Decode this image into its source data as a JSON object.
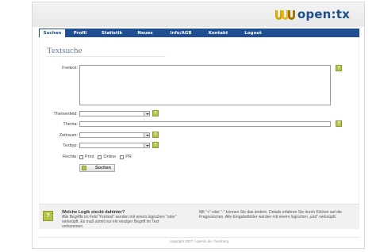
{
  "logo": {
    "text": "open:tx"
  },
  "nav": {
    "tabs": [
      {
        "label": "Suchen"
      },
      {
        "label": "Profil"
      },
      {
        "label": "Statistik"
      },
      {
        "label": "Neues"
      },
      {
        "label": "Info/AGB"
      },
      {
        "label": "Kontakt"
      },
      {
        "label": "Logout"
      }
    ],
    "active_tab": "Suchen"
  },
  "form": {
    "title": "Textsuche",
    "freitext_label": "Freitext:",
    "freitext_value": "",
    "themenfeld_label": "Themenfeld:",
    "themenfeld_value": "",
    "thema_label": "Thema:",
    "thema_value": "",
    "zeitraum_label": "Zeitraum:",
    "zeitraum_value": "",
    "texttyp_label": "Texttyp:",
    "texttyp_value": "",
    "rechte_label": "Rechte:",
    "rechte_options": [
      "Print",
      "Online",
      "PR"
    ],
    "search_button": "Suchen",
    "help_glyph": "?"
  },
  "info": {
    "title": "Welche Logik steckt dahinter?",
    "left_text": "Alle Begriffe im Feld \"Freitext\" werden mit einem logischen \"oder\" verknüpft. Es muß somit nur ein einziger Begriff im Text vorkommen.",
    "right_text": "Mit \"+\" oder \"-\" können Sie das ändern. Details erfahren Sie durch Klicken auf die Fragezeichen. Alle Eingabefelder werden mit einem logischen „und“ verknüpft."
  },
  "footer": {
    "copyright": "copyright 2007 / opentx.de / hamburg"
  },
  "colors": {
    "nav": "#1f4e93",
    "help": "#b7c44a",
    "logo_text": "#1c4f8a",
    "logo_mark": "#d8a400"
  },
  "icons": {
    "help": "question-mark-icon",
    "logo": "waves-logo-icon",
    "dropdown": "chevron-down-icon"
  }
}
